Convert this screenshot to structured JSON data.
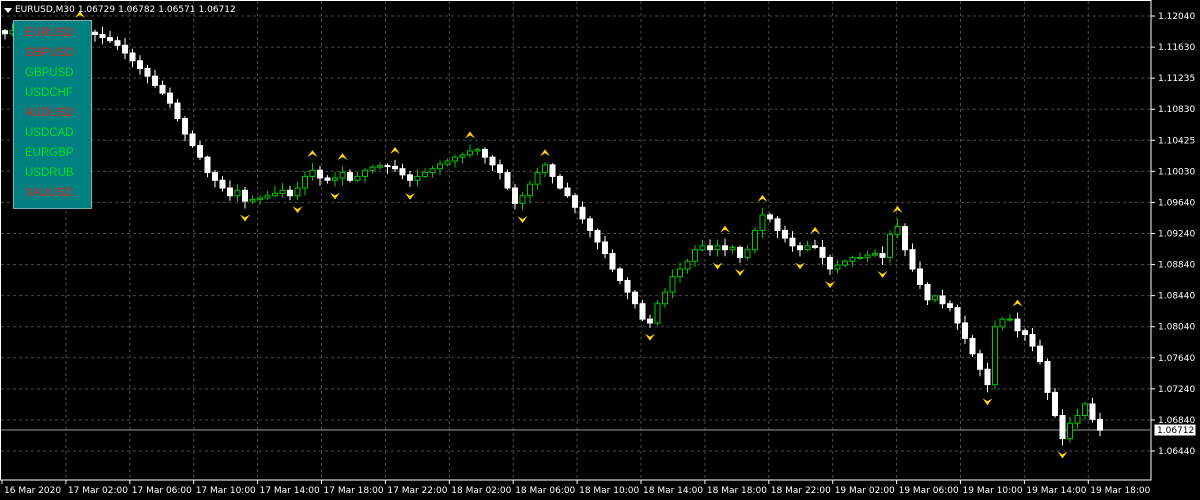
{
  "header": {
    "symbol": "EURUSD,M30",
    "ohlc": [
      "1.06729",
      "1.06782",
      "1.06571",
      "1.06712"
    ]
  },
  "colors": {
    "background": "#000000",
    "grid": "#4a4a4a",
    "text": "#ffffff",
    "bull": "#00c800",
    "bear": "#ffffff",
    "arrow": "#ffd700",
    "panel": "#008080",
    "up_symbol": "#00e020",
    "down_symbol": "#e02020"
  },
  "symbols_panel": [
    {
      "symbol": "EURUSD",
      "color": "#e82020"
    },
    {
      "symbol": "GBPUSD",
      "color": "#e82020"
    },
    {
      "symbol": "GBPUSD",
      "color": "#00e020"
    },
    {
      "symbol": "USDCHF",
      "color": "#00e020"
    },
    {
      "symbol": "AUDUSD",
      "color": "#e82020"
    },
    {
      "symbol": "USDCAD",
      "color": "#00e020"
    },
    {
      "symbol": "EURGBP",
      "color": "#00e020"
    },
    {
      "symbol": "USDRUB",
      "color": "#00e020"
    },
    {
      "symbol": "XAUUSD",
      "color": "#e82020"
    }
  ],
  "chart_data": {
    "type": "candlestick",
    "ylim": [
      1.0644,
      1.1208
    ],
    "y_ticks": [
      "1.12040",
      "1.11630",
      "1.11235",
      "1.10830",
      "1.10425",
      "1.10030",
      "1.09640",
      "1.09240",
      "1.08840",
      "1.08440",
      "1.08040",
      "1.07640",
      "1.07240",
      "1.06840",
      "1.06440"
    ],
    "x_ticks": [
      "16 Mar 2020",
      "17 Mar 02:00",
      "17 Mar 06:00",
      "17 Mar 10:00",
      "17 Mar 14:00",
      "17 Mar 18:00",
      "17 Mar 22:00",
      "18 Mar 02:00",
      "18 Mar 06:00",
      "18 Mar 10:00",
      "18 Mar 14:00",
      "18 Mar 18:00",
      "18 Mar 22:00",
      "19 Mar 02:00",
      "19 Mar 06:00",
      "19 Mar 10:00",
      "19 Mar 14:00",
      "19 Mar 18:00"
    ],
    "current_price": "1.06712",
    "closes": [
      1.1185,
      1.1189,
      1.1178,
      1.119,
      1.1185,
      1.118,
      1.1176,
      1.118,
      1.1183,
      1.1185,
      1.1188,
      1.1187,
      1.1184,
      1.118,
      1.1176,
      1.117,
      1.116,
      1.115,
      1.114,
      1.113,
      1.1118,
      1.1108,
      1.1095,
      1.1075,
      1.1055,
      1.104,
      1.1025,
      1.1005,
      1.0995,
      1.0985,
      1.0975,
      1.0982,
      1.0968,
      1.097,
      1.0972,
      1.0975,
      1.0978,
      1.0982,
      1.0975,
      1.0985,
      1.1,
      1.1008,
      1.0998,
      1.0995,
      1.0998,
      1.1005,
      1.0995,
      1.1,
      1.1008,
      1.1012,
      1.1014,
      1.1013,
      1.101,
      1.1002,
      1.0995,
      1.1,
      1.1005,
      1.101,
      1.1016,
      1.102,
      1.1025,
      1.1028,
      1.1033,
      1.1035,
      1.1025,
      1.1015,
      1.1005,
      1.0985,
      1.0965,
      1.0975,
      1.099,
      1.1005,
      1.1015,
      1.1,
      1.0985,
      1.0975,
      1.096,
      1.0945,
      1.093,
      1.0915,
      1.09,
      1.088,
      1.0865,
      1.085,
      1.0835,
      1.0815,
      1.081,
      1.0835,
      1.085,
      1.087,
      1.088,
      1.089,
      1.0905,
      1.091,
      1.0905,
      1.091,
      1.0905,
      1.0908,
      1.0895,
      1.0905,
      1.093,
      1.095,
      1.0945,
      1.093,
      1.092,
      1.091,
      1.0905,
      1.091,
      1.0908,
      1.0895,
      1.088,
      1.0885,
      1.089,
      1.0895,
      1.0895,
      1.0898,
      1.09,
      1.0895,
      1.0925,
      1.0935,
      1.0905,
      1.088,
      1.086,
      1.084,
      1.0845,
      1.0835,
      1.083,
      1.081,
      1.079,
      1.077,
      1.075,
      1.073,
      1.0805,
      1.0815,
      1.0815,
      1.08,
      1.0795,
      1.078,
      1.076,
      1.072,
      1.069,
      1.066,
      1.068,
      1.069,
      1.0705,
      1.0685,
      1.0671
    ]
  }
}
